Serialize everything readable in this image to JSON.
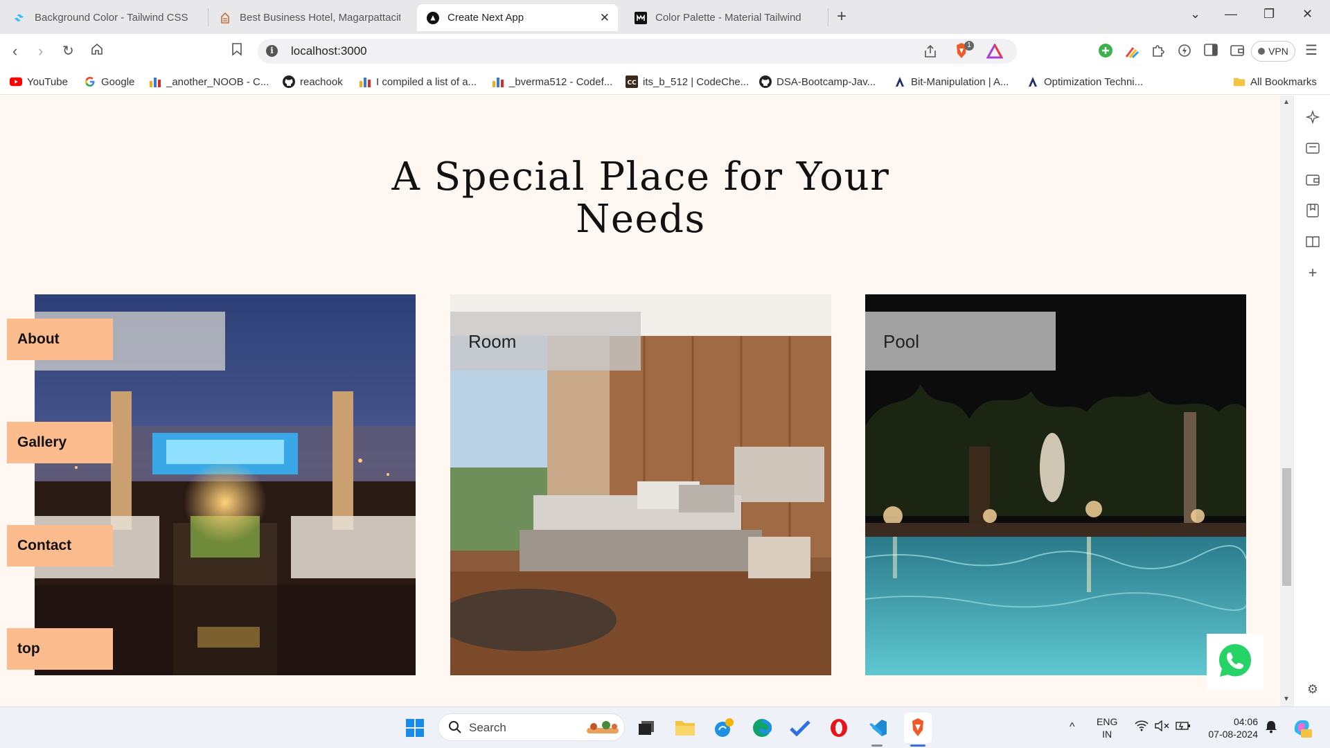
{
  "browser": {
    "tabs": [
      {
        "title": "Background Color - Tailwind CSS",
        "icon": "tailwind-icon",
        "active": false
      },
      {
        "title": "Best Business Hotel, Magarpattacity",
        "icon": "hotel-icon",
        "active": false
      },
      {
        "title": "Create Next App",
        "icon": "nextjs-icon",
        "active": true
      },
      {
        "title": "Color Palette - Material Tailwind",
        "icon": "material-tailwind-icon",
        "active": false
      }
    ],
    "url": "localhost:3000",
    "vpn_label": "VPN",
    "brave_badge": "1",
    "bookmarks": [
      {
        "label": "YouTube",
        "icon": "youtube-icon"
      },
      {
        "label": "Google",
        "icon": "google-icon"
      },
      {
        "label": "_another_NOOB - C...",
        "icon": "chart-icon"
      },
      {
        "label": "reachook",
        "icon": "github-icon"
      },
      {
        "label": "I compiled a list of a...",
        "icon": "chart-icon"
      },
      {
        "label": "_bverma512 - Codef...",
        "icon": "chart-icon"
      },
      {
        "label": "its_b_512 | CodeChe...",
        "icon": "codechef-icon"
      },
      {
        "label": "DSA-Bootcamp-Jav...",
        "icon": "github-icon"
      },
      {
        "label": "Bit-Manipulation | A...",
        "icon": "a-icon"
      },
      {
        "label": "Optimization Techni...",
        "icon": "a-icon"
      }
    ],
    "all_bookmarks": "All Bookmarks"
  },
  "page": {
    "heading": "A Special Place for Your Needs",
    "cards": [
      {
        "label": "",
        "image": "rooftop-restaurant-night"
      },
      {
        "label": "Room",
        "image": "hotel-bedroom"
      },
      {
        "label": "Pool",
        "image": "pool-night"
      }
    ],
    "side_nav": [
      "About",
      "Gallery",
      "Contact",
      "top"
    ]
  },
  "taskbar": {
    "search_label": "Search",
    "lang_top": "ENG",
    "lang_bottom": "IN",
    "time": "04:06",
    "date": "07-08-2024"
  },
  "colors": {
    "page_bg": "#fef7f2",
    "nav_button_bg": "#fdbc8e",
    "card_label_bg": "#c8c8c8"
  }
}
